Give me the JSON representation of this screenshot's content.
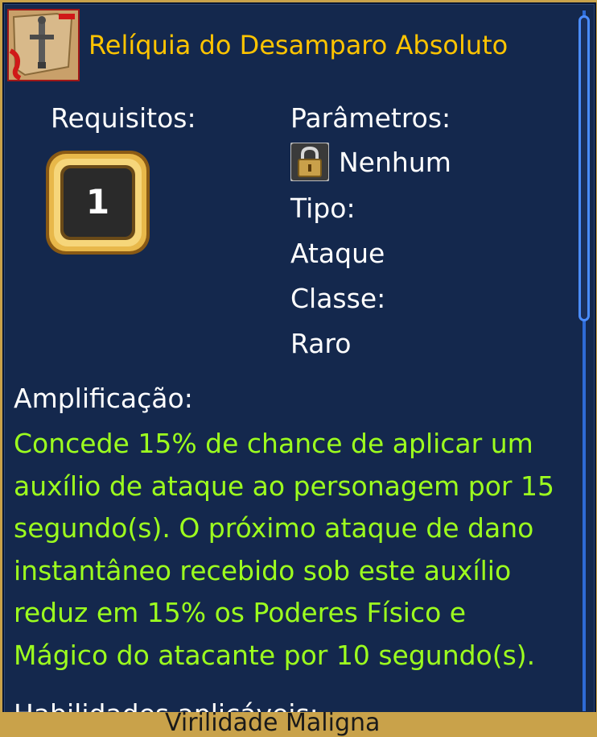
{
  "item": {
    "name": "Relíquia do Desamparo Absoluto",
    "icon": "sword-relic-icon"
  },
  "requirements": {
    "label": "Requisitos:",
    "level": "1"
  },
  "parameters": {
    "label": "Parâmetros:",
    "value": "Nenhum",
    "lock_icon": "lock-icon"
  },
  "type": {
    "label": "Tipo:",
    "value": "Ataque"
  },
  "class": {
    "label": "Classe:",
    "value": "Raro"
  },
  "amplification": {
    "label": "Amplificação:",
    "lines": [
      "Concede 15% de chance de aplicar um",
      "auxílio de ataque ao personagem por 15",
      "segundo(s). O próximo ataque de dano",
      "instantâneo recebido sob este auxílio",
      "reduz em 15% os Poderes Físico e",
      "Mágico do atacante por 10 segundo(s)."
    ]
  },
  "next_section": {
    "label_partial": "Habilidades aplicáveis:",
    "below_partial": "Virilidade Maligna"
  },
  "colors": {
    "panel": "#14284d",
    "title": "#ffc400",
    "text": "#ffffff",
    "description": "#9dff1e",
    "scroll": "#4a8cff",
    "frame": "#c9a24a"
  }
}
